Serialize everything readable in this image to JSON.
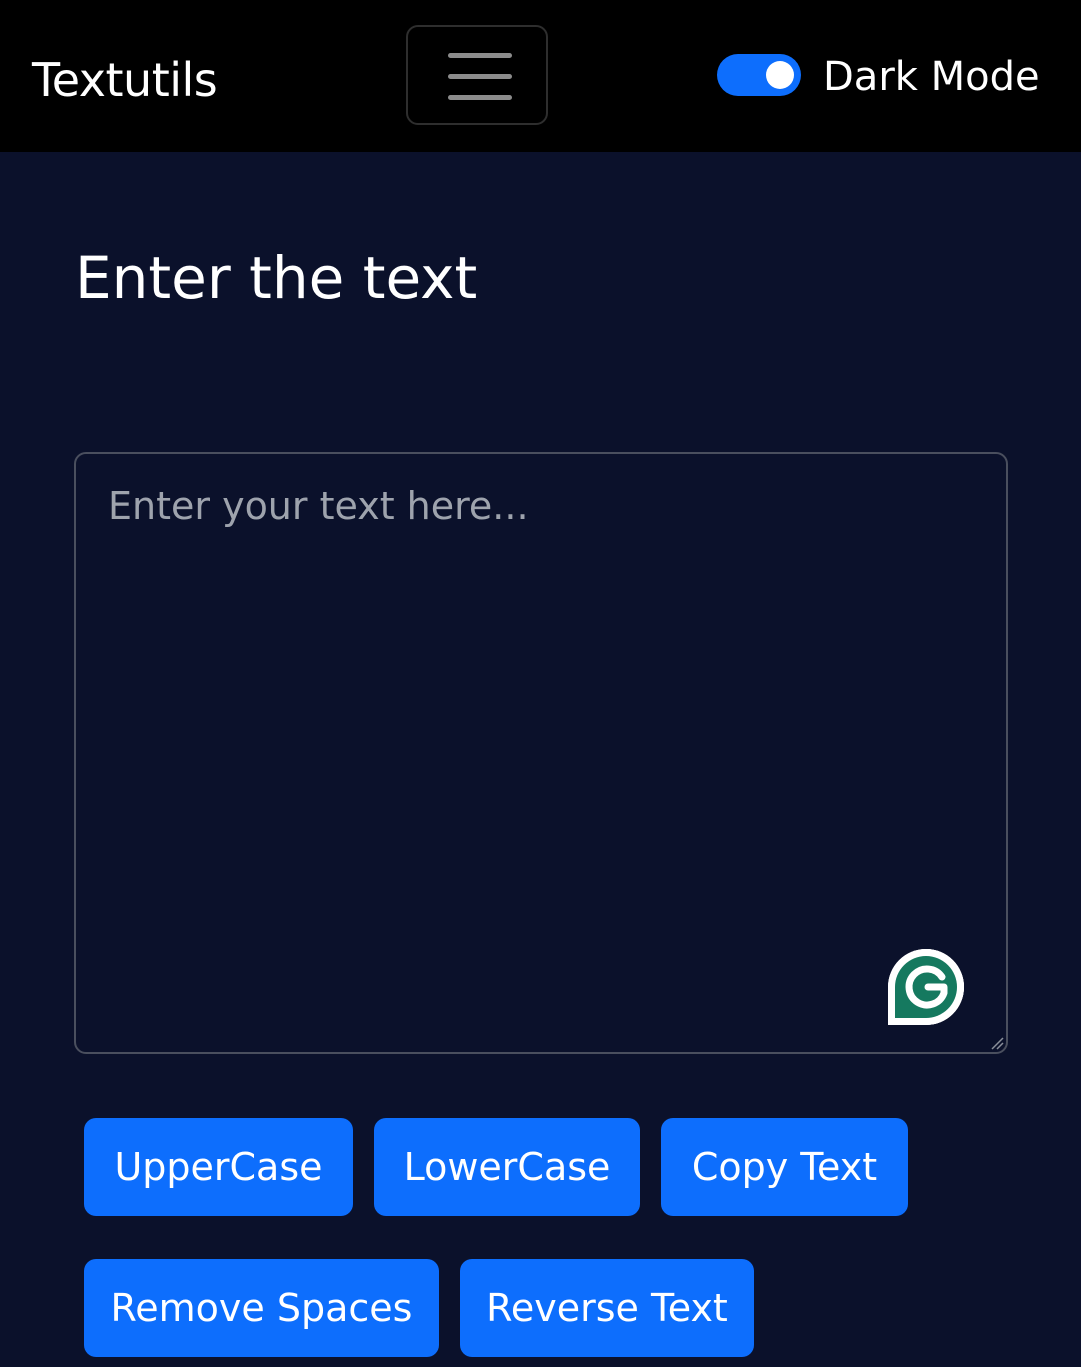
{
  "navbar": {
    "brand": "Textutils",
    "menu_icon": "hamburger-menu-icon",
    "dark_mode_label": "Dark Mode",
    "dark_mode_enabled": true
  },
  "main": {
    "heading": "Enter the text",
    "textarea": {
      "value": "",
      "placeholder": "Enter your text here..."
    },
    "grammarly_icon": "grammarly-icon"
  },
  "buttons": {
    "uppercase": "UpperCase",
    "lowercase": "LowerCase",
    "copy": "Copy Text",
    "remove_spaces": "Remove Spaces",
    "reverse": "Reverse Text"
  },
  "colors": {
    "navbar_bg": "#000000",
    "page_bg": "#0b112b",
    "primary": "#0d6efd",
    "grammarly_green": "#15795f"
  }
}
